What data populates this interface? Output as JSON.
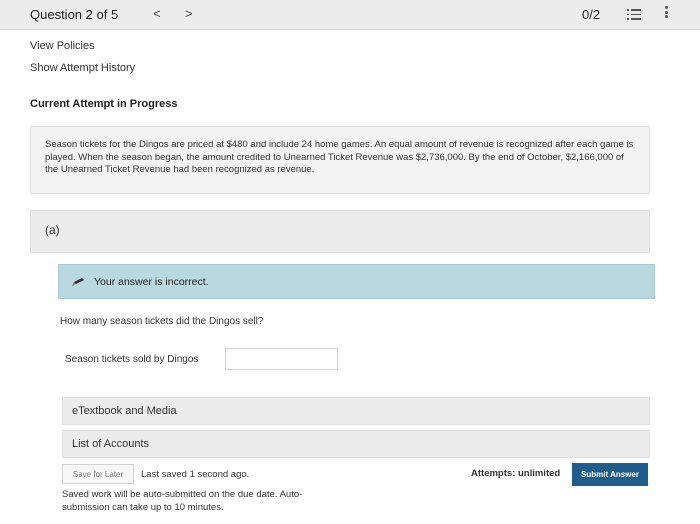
{
  "header": {
    "question_title": "Question 2 of 5",
    "prev_glyph": "<",
    "next_glyph": ">",
    "score": "0/2"
  },
  "links": {
    "view_policies": "View Policies",
    "show_attempt_history": "Show Attempt History"
  },
  "attempt_heading": "Current Attempt in Progress",
  "question": {
    "text": "Season tickets for the Dingos are priced at $480 and include 24 home games. An equal amount of revenue is recognized after each game is played. When the season began, the amount credited to Unearned Ticket Revenue was $2,736,000. By the end of October, $2,166,000 of the Unearned Ticket Revenue had been recognized as revenue."
  },
  "part": {
    "label": "(a)",
    "feedback": "Your answer is incorrect.",
    "prompt": "How many season tickets did the Dingos sell?",
    "answer_label": "Season tickets sold by Dingos",
    "answer_value": ""
  },
  "accordions": {
    "etextbook": "eTextbook and Media",
    "accounts": "List of Accounts"
  },
  "footer": {
    "save_label": "Save for Later",
    "last_saved": "Last saved 1 second ago.",
    "autosubmit_note": "Saved work will be auto-submitted on the due date. Auto-submission can take up to 10 minutes.",
    "attempts": "Attempts: unlimited",
    "submit_label": "Submit Answer"
  },
  "colors": {
    "feedback_bg": "#b9d9df",
    "submit_bg": "#1f5d8c"
  },
  "icons": {
    "list": "list-icon",
    "more": "more-vertical-icon",
    "feedback": "pencil-icon"
  }
}
